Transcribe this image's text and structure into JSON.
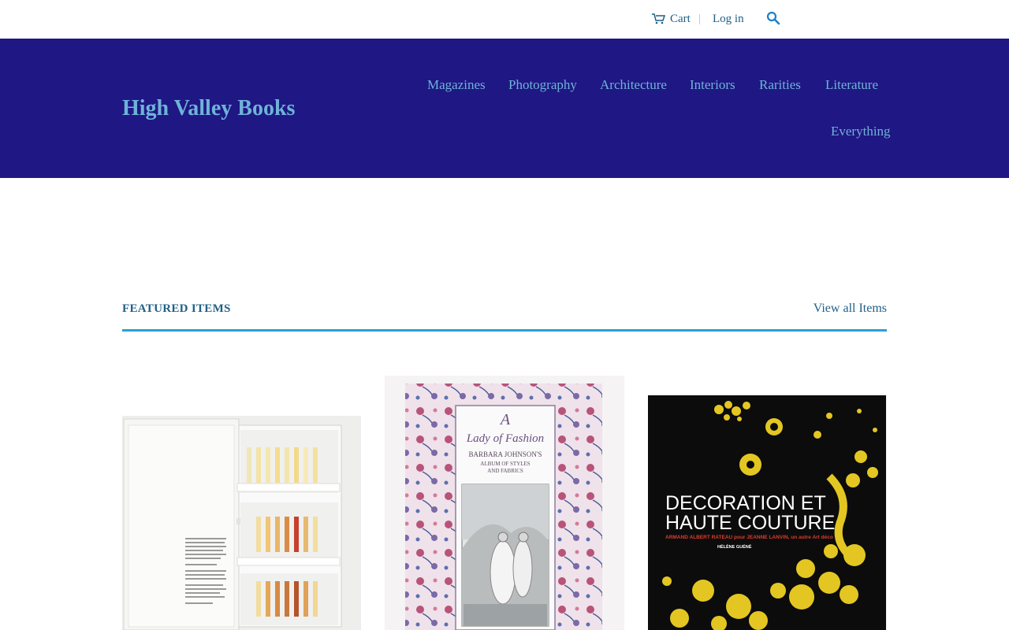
{
  "topbar": {
    "cart_label": "Cart",
    "separator": "|",
    "login_label": "Log in",
    "search_icon": "search-icon",
    "cart_icon": "cart-icon"
  },
  "header": {
    "brand": "High Valley Books",
    "nav": [
      "Magazines",
      "Photography",
      "Architecture",
      "Interiors",
      "Rarities",
      "Literature",
      "Everything"
    ]
  },
  "featured": {
    "title": "FEATURED ITEMS",
    "view_all": "View all Items",
    "products": [
      {
        "image_text": []
      },
      {
        "image_text": [
          "A",
          "Lady of Fashion",
          "BARBARA JOHNSON'S",
          "ALBUM OF STYLES",
          "AND FABRICS"
        ]
      },
      {
        "image_text": [
          "DECORATION ET",
          "HAUTE COUTURE",
          "ARMAND ALBERT RATEAU pour JEANNE LANVIN, un autre Art déco",
          "HÉLÈNE GUÉNÉ"
        ]
      }
    ]
  },
  "colors": {
    "header_bg": "#1f1783",
    "link": "#1f5f86",
    "nav": "#6fb3d8",
    "accent_rule": "#2a9fd6"
  }
}
